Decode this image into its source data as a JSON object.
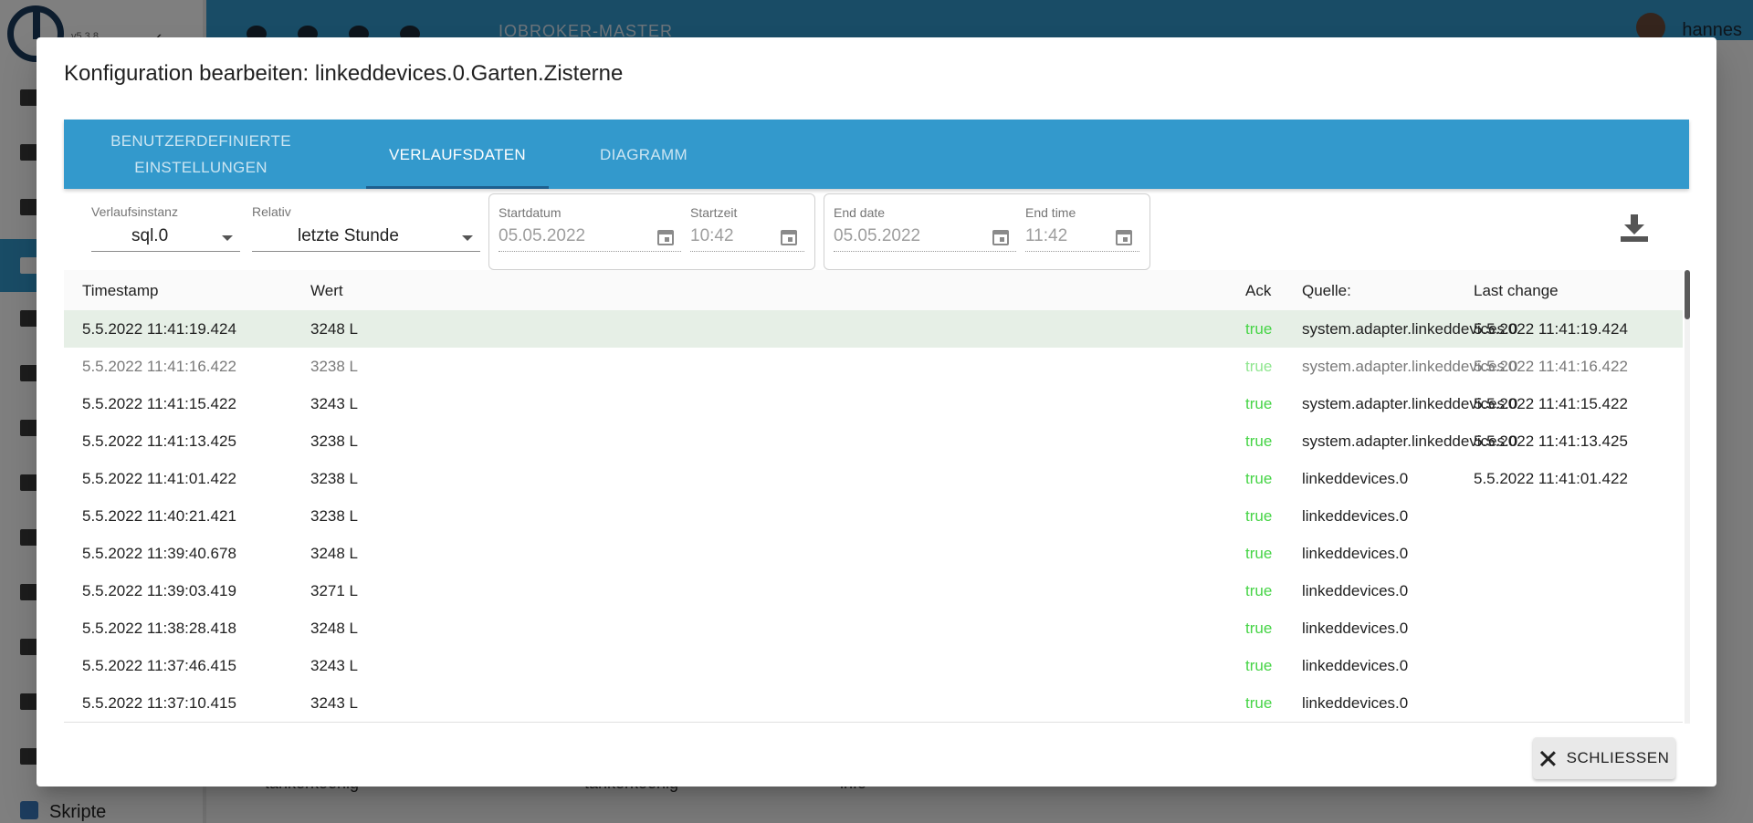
{
  "app": {
    "version": "v5.3.8",
    "topbar_title": "IOBROKER-MASTER",
    "user_name": "hannes",
    "sidebar_bottom_label": "Skripte",
    "bg_rows": [
      {
        "a": "tankerkoenig",
        "b": "tankerkoenig",
        "c": "info"
      }
    ]
  },
  "dialog": {
    "title": "Konfiguration bearbeiten: linkeddevices.0.Garten.Zisterne",
    "tabs": [
      {
        "label": "Benutzerdefinierte Einstellungen",
        "line1": "BENUTZERDEFINIERTE",
        "line2": "EINSTELLUNGEN"
      },
      {
        "label": "VERLAUFSDATEN"
      },
      {
        "label": "DIAGRAMM"
      }
    ],
    "active_tab": "VERLAUFSDATEN",
    "filters": {
      "instance_label": "Verlaufsinstanz",
      "instance_value": "sql.0",
      "relative_label": "Relativ",
      "relative_value": "letzte Stunde",
      "start_date_label": "Startdatum",
      "start_date_value": "05.05.2022",
      "start_time_label": "Startzeit",
      "start_time_value": "10:42",
      "end_date_label": "End date",
      "end_date_value": "05.05.2022",
      "end_time_label": "End time",
      "end_time_value": "11:42"
    },
    "table": {
      "headers": {
        "timestamp": "Timestamp",
        "value": "Wert",
        "ack": "Ack",
        "source": "Quelle:",
        "last_change": "Last change"
      },
      "rows": [
        {
          "timestamp": "5.5.2022 11:41:19.424",
          "value": "3248 L",
          "ack": "true",
          "source": "system.adapter.linkeddevices.0",
          "last_change": "5.5.2022 11:41:19.424"
        },
        {
          "timestamp": "5.5.2022 11:41:16.422",
          "value": "3238 L",
          "ack": "true",
          "source": "system.adapter.linkeddevices.0",
          "last_change": "5.5.2022 11:41:16.422"
        },
        {
          "timestamp": "5.5.2022 11:41:15.422",
          "value": "3243 L",
          "ack": "true",
          "source": "system.adapter.linkeddevices.0",
          "last_change": "5.5.2022 11:41:15.422"
        },
        {
          "timestamp": "5.5.2022 11:41:13.425",
          "value": "3238 L",
          "ack": "true",
          "source": "system.adapter.linkeddevices.0",
          "last_change": "5.5.2022 11:41:13.425"
        },
        {
          "timestamp": "5.5.2022 11:41:01.422",
          "value": "3238 L",
          "ack": "true",
          "source": "linkeddevices.0",
          "last_change": "5.5.2022 11:41:01.422"
        },
        {
          "timestamp": "5.5.2022 11:40:21.421",
          "value": "3238 L",
          "ack": "true",
          "source": "linkeddevices.0",
          "last_change": ""
        },
        {
          "timestamp": "5.5.2022 11:39:40.678",
          "value": "3248 L",
          "ack": "true",
          "source": "linkeddevices.0",
          "last_change": ""
        },
        {
          "timestamp": "5.5.2022 11:39:03.419",
          "value": "3271 L",
          "ack": "true",
          "source": "linkeddevices.0",
          "last_change": ""
        },
        {
          "timestamp": "5.5.2022 11:38:28.418",
          "value": "3248 L",
          "ack": "true",
          "source": "linkeddevices.0",
          "last_change": ""
        },
        {
          "timestamp": "5.5.2022 11:37:46.415",
          "value": "3243 L",
          "ack": "true",
          "source": "linkeddevices.0",
          "last_change": ""
        },
        {
          "timestamp": "5.5.2022 11:37:10.415",
          "value": "3243 L",
          "ack": "true",
          "source": "linkeddevices.0",
          "last_change": ""
        }
      ]
    },
    "close_label": "SCHLIESSEN"
  },
  "colors": {
    "accent": "#3399cc",
    "ack_true": "#46d446",
    "selected_row": "#e6efe6"
  }
}
